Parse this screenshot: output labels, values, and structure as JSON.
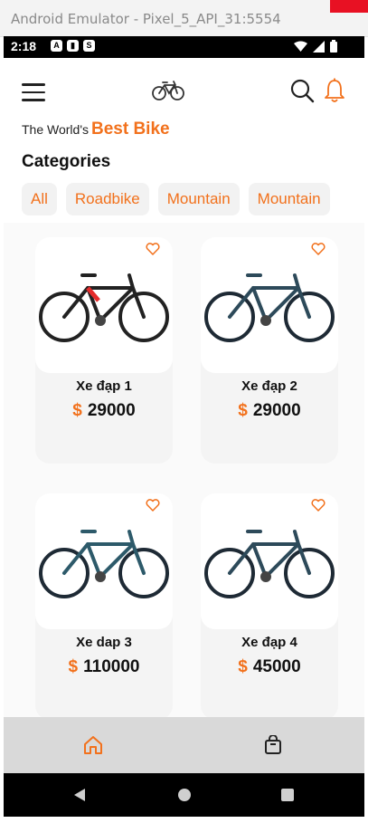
{
  "window": {
    "title": "Android Emulator - Pixel_5_API_31:5554"
  },
  "status_bar": {
    "time": "2:18"
  },
  "header": {
    "tagline_prefix": "The World's",
    "tagline_highlight": "Best Bike"
  },
  "categories": {
    "title": "Categories",
    "items": [
      "All",
      "Roadbike",
      "Mountain",
      "Mountain"
    ]
  },
  "products": [
    {
      "name": "Xe đạp 1",
      "currency": "$",
      "price": "29000"
    },
    {
      "name": "Xe đạp 2",
      "currency": "$",
      "price": "29000"
    },
    {
      "name": "Xe dap 3",
      "currency": "$",
      "price": "110000"
    },
    {
      "name": "Xe đạp 4",
      "currency": "$",
      "price": "45000"
    }
  ],
  "bottom_nav": {
    "active": "home"
  },
  "colors": {
    "accent": "#f2711c",
    "nav_bg": "#d9d9d9",
    "card_bg": "#f4f4f4"
  },
  "icons": [
    "menu-icon",
    "bicycle-icon",
    "search-icon",
    "bell-icon",
    "heart-icon",
    "home-icon",
    "shopping-bag-icon",
    "back-icon",
    "home-circle-icon",
    "recents-icon"
  ]
}
